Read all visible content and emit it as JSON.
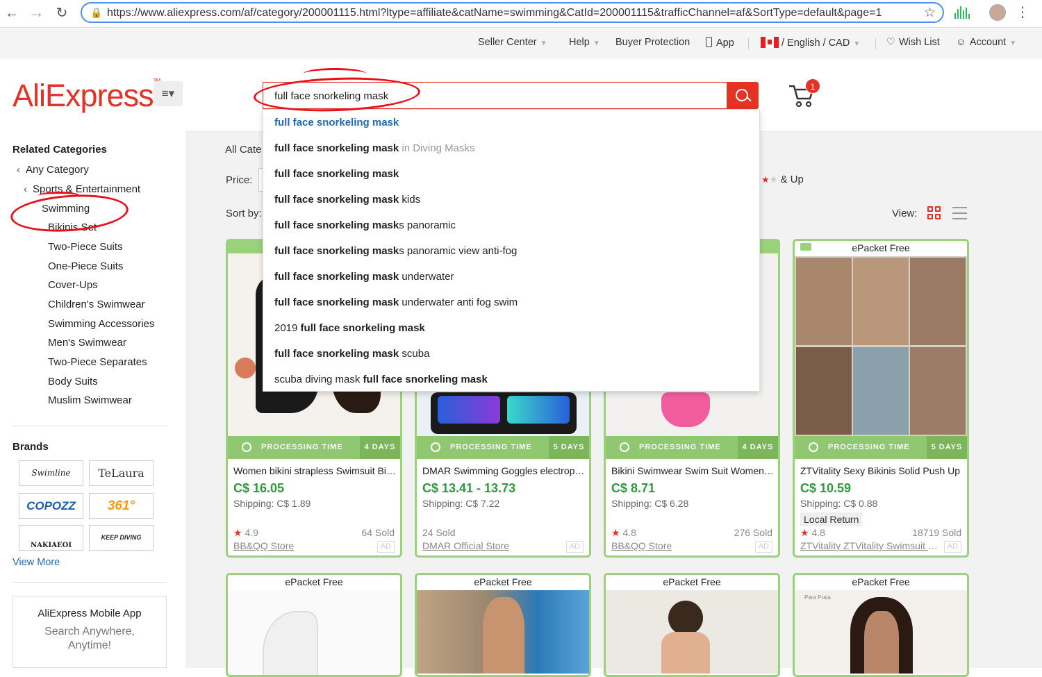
{
  "browser": {
    "url": "https://www.aliexpress.com/af/category/200001115.html?ltype=affiliate&catName=swimming&CatId=200001115&trafficChannel=af&SortType=default&page=1"
  },
  "topbar": {
    "seller_center": "Seller Center",
    "help": "Help",
    "buyer_protection": "Buyer Protection",
    "app": "App",
    "locale": "/ English /  CAD",
    "wish_list": "Wish List",
    "account": "Account"
  },
  "header": {
    "logo": "AliExpress",
    "search_value": "full face snorkeling mask",
    "cart_count": "1"
  },
  "suggestions": [
    {
      "bold": "full face snorkeling mask",
      "rest": "",
      "cat": "",
      "pre": ""
    },
    {
      "bold": "full face snorkeling mask",
      "rest": "",
      "cat": " in Diving Masks",
      "pre": ""
    },
    {
      "bold": "full face snorkeling mask",
      "rest": "",
      "cat": "",
      "pre": ""
    },
    {
      "bold": "full face snorkeling mask",
      "rest": " kids",
      "cat": "",
      "pre": ""
    },
    {
      "bold": "full face snorkeling mask",
      "rest": "s panoramic",
      "cat": "",
      "pre": ""
    },
    {
      "bold": "full face snorkeling mask",
      "rest": "s panoramic view anti-fog",
      "cat": "",
      "pre": ""
    },
    {
      "bold": "full face snorkeling mask",
      "rest": " underwater",
      "cat": "",
      "pre": ""
    },
    {
      "bold": "full face snorkeling mask",
      "rest": " underwater anti fog swim",
      "cat": "",
      "pre": ""
    },
    {
      "bold": "full face snorkeling mask",
      "rest": "",
      "cat": "",
      "pre": "2019 "
    },
    {
      "bold": "full face snorkeling mask",
      "rest": " scuba",
      "cat": "",
      "pre": ""
    },
    {
      "bold": "full face snorkeling mask",
      "rest": "",
      "cat": "",
      "pre": "scuba diving mask "
    }
  ],
  "sidebar": {
    "related_title": "Related Categories",
    "any_category": "Any Category",
    "parent": "Sports & Entertainment",
    "current": "Swimming",
    "subcats": [
      "Bikinis Set",
      "Two-Piece Suits",
      "One-Piece Suits",
      "Cover-Ups",
      "Children's Swimwear",
      "Swimming Accessories",
      "Men's Swimwear",
      "Two-Piece Separates",
      "Body Suits",
      "Muslim Swimwear"
    ],
    "brands_title": "Brands",
    "brands": [
      "Swimline",
      "TeLaura",
      "COPOZZ",
      "361°",
      "NAKIAEOI",
      "KEEP DIVING"
    ],
    "view_more": "View More",
    "app_title": "AliExpress Mobile App",
    "app_sub": "Search Anywhere, Anytime!"
  },
  "filters": {
    "all_categories": "All Cate",
    "price": "Price:",
    "and_up": "& Up",
    "sort_by": "Sort by:",
    "view": "View:"
  },
  "products": [
    {
      "epacket": "",
      "processing": "PROCESSING TIME",
      "days": "4 DAYS",
      "title": "Women bikini strapless Swimsuit Bikini set",
      "price": "C$ 16.05",
      "shipping": "Shipping: C$ 1.89",
      "local_return": "",
      "rating": "4.9",
      "sold": "64 Sold",
      "store": "BB&QQ Store",
      "ad": "AD",
      "img_color": "#f3ece6"
    },
    {
      "epacket": "",
      "processing": "PROCESSING TIME",
      "days": "5 DAYS",
      "title": "DMAR Swimming Goggles electroplate",
      "price": "C$ 13.41 - 13.73",
      "shipping": "Shipping: C$ 7.22",
      "local_return": "",
      "rating": "",
      "sold": "24 Sold",
      "store": "DMAR Official Store",
      "ad": "AD",
      "img_color": "#d9e8f2"
    },
    {
      "epacket": "",
      "processing": "PROCESSING TIME",
      "days": "4 DAYS",
      "title": "Bikini Swimwear Swim Suit Women Sexy",
      "price": "C$ 8.71",
      "shipping": "Shipping: C$ 6.28",
      "local_return": "",
      "rating": "4.8",
      "sold": "276 Sold",
      "store": "BB&QQ Store",
      "ad": "AD",
      "img_color": "#f1eeee"
    },
    {
      "epacket": "ePacket Free",
      "processing": "PROCESSING TIME",
      "days": "5 DAYS",
      "title": "ZTVitality Sexy Bikinis Solid Push Up",
      "price": "C$ 10.59",
      "shipping": "Shipping: C$ 0.88",
      "local_return": "Local Return",
      "rating": "4.8",
      "sold": "18719 Sold",
      "store": "ZTVitality ZTVitality Swimsuit Store",
      "ad": "AD",
      "img_color": "#c9b6a8"
    }
  ],
  "row2": [
    {
      "epacket": "ePacket Free",
      "img_color": "#f4f4f4"
    },
    {
      "epacket": "ePacket Free",
      "img_color": "#b89a7c"
    },
    {
      "epacket": "ePacket Free",
      "img_color": "#e6e2dc"
    },
    {
      "epacket": "ePacket Free",
      "img_color": "#d8cfc8"
    }
  ],
  "row2_4_brand": "Para Praia",
  "colors": {
    "accent": "#e43225",
    "green": "#8fc870",
    "link": "#2169b8"
  }
}
